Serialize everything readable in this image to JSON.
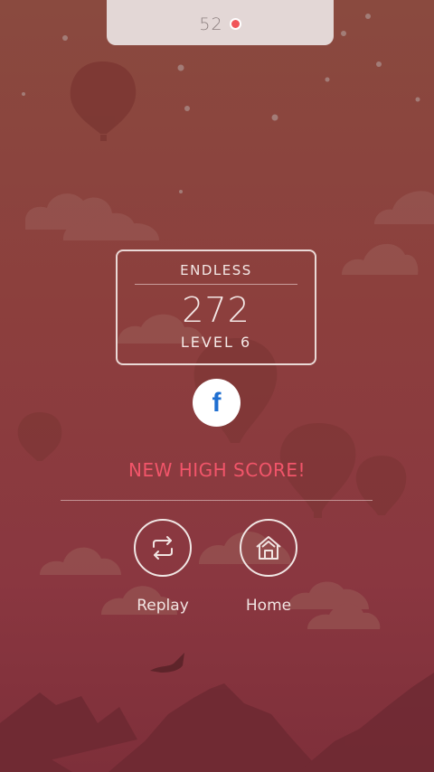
{
  "header": {
    "coins": "52"
  },
  "score_card": {
    "mode": "ENDLESS",
    "score": "272",
    "level": "LEVEL 6"
  },
  "share": {
    "facebook_glyph": "f"
  },
  "result": {
    "message": "NEW HIGH SCORE!"
  },
  "actions": {
    "replay_label": "Replay",
    "home_label": "Home"
  },
  "colors": {
    "background_top": "#8a4a3f",
    "background_bottom": "#7e2f3a",
    "panel": "#e3d7d6",
    "accent_red": "#f2556a",
    "facebook_blue": "#1f6fd1"
  },
  "icons": [
    "coin-icon",
    "facebook-icon",
    "replay-icon",
    "home-icon"
  ]
}
